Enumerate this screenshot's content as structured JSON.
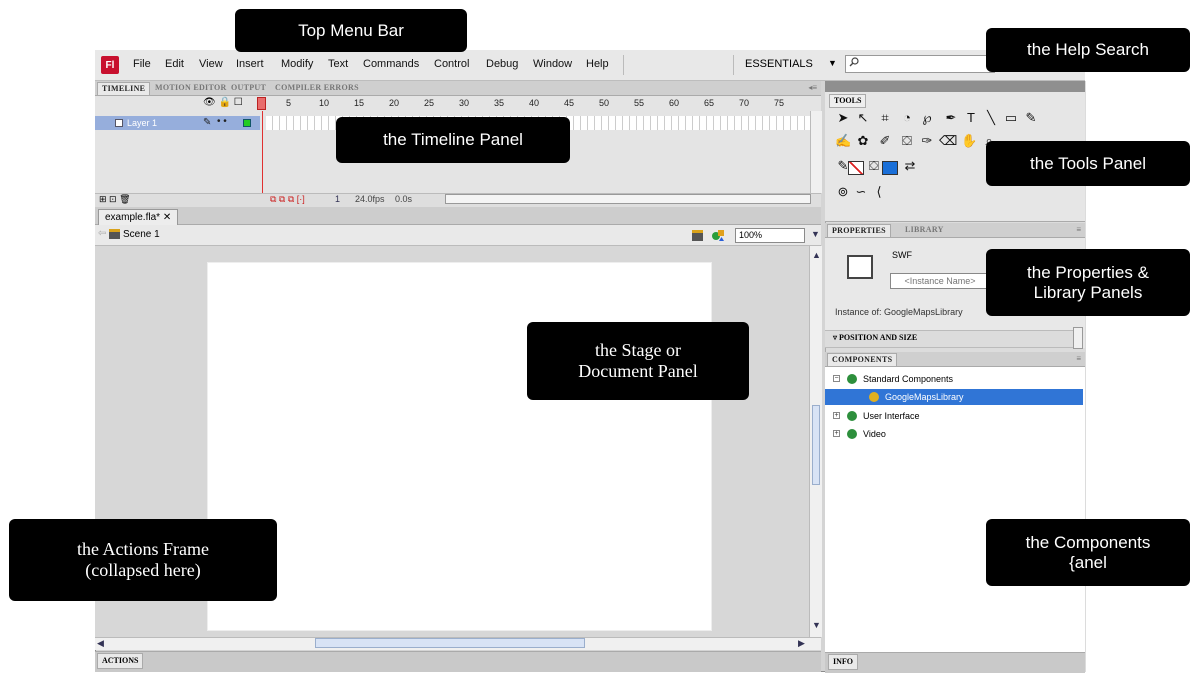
{
  "menubar": {
    "logo": "Fl",
    "items": [
      "File",
      "Edit",
      "View",
      "Insert",
      "Modify",
      "Text",
      "Commands",
      "Control",
      "Debug",
      "Window",
      "Help"
    ],
    "workspace": "ESSENTIALS",
    "search_placeholder": ""
  },
  "timeline": {
    "tabs": [
      "TIMELINE",
      "MOTION EDITOR",
      "OUTPUT",
      "COMPILER ERRORS"
    ],
    "frame_numbers": [
      "1",
      "5",
      "10",
      "15",
      "20",
      "25",
      "30",
      "35",
      "40",
      "45",
      "50",
      "55",
      "60",
      "65",
      "70",
      "75"
    ],
    "layer_name": "Layer 1",
    "current_frame": "1",
    "fps": "24.0fps",
    "time": "0.0s"
  },
  "document": {
    "tab": "example.fla*",
    "scene": "Scene 1",
    "zoom": "100%"
  },
  "actions": {
    "tab": "ACTIONS"
  },
  "tools": {
    "tab": "TOOLS"
  },
  "properties": {
    "tabs": [
      "PROPERTIES",
      "LIBRARY"
    ],
    "type": "SWF",
    "instance_name_placeholder": "<Instance Name>",
    "instance_of": "Instance of: GoogleMapsLibrary",
    "section": "POSITION AND SIZE"
  },
  "components": {
    "tab": "COMPONENTS",
    "tree": [
      {
        "label": "Standard Components",
        "expander": "⊟",
        "level": 0
      },
      {
        "label": "GoogleMapsLibrary",
        "expander": "",
        "level": 1,
        "selected": true
      },
      {
        "label": "User Interface",
        "expander": "⊞",
        "level": 0
      },
      {
        "label": "Video",
        "expander": "⊞",
        "level": 0
      }
    ]
  },
  "info": {
    "tab": "INFO"
  },
  "callouts": {
    "top_menu_bar": "Top Menu Bar",
    "help_search": "the Help Search",
    "timeline_panel": "the Timeline Panel",
    "tools_panel": "the Tools Panel",
    "properties_library": "the Properties &\nLibrary Panels",
    "stage": "the Stage or\nDocument Panel",
    "actions_frame": "the Actions Frame\n(collapsed here)",
    "components_panel": "the Components\n{anel"
  }
}
